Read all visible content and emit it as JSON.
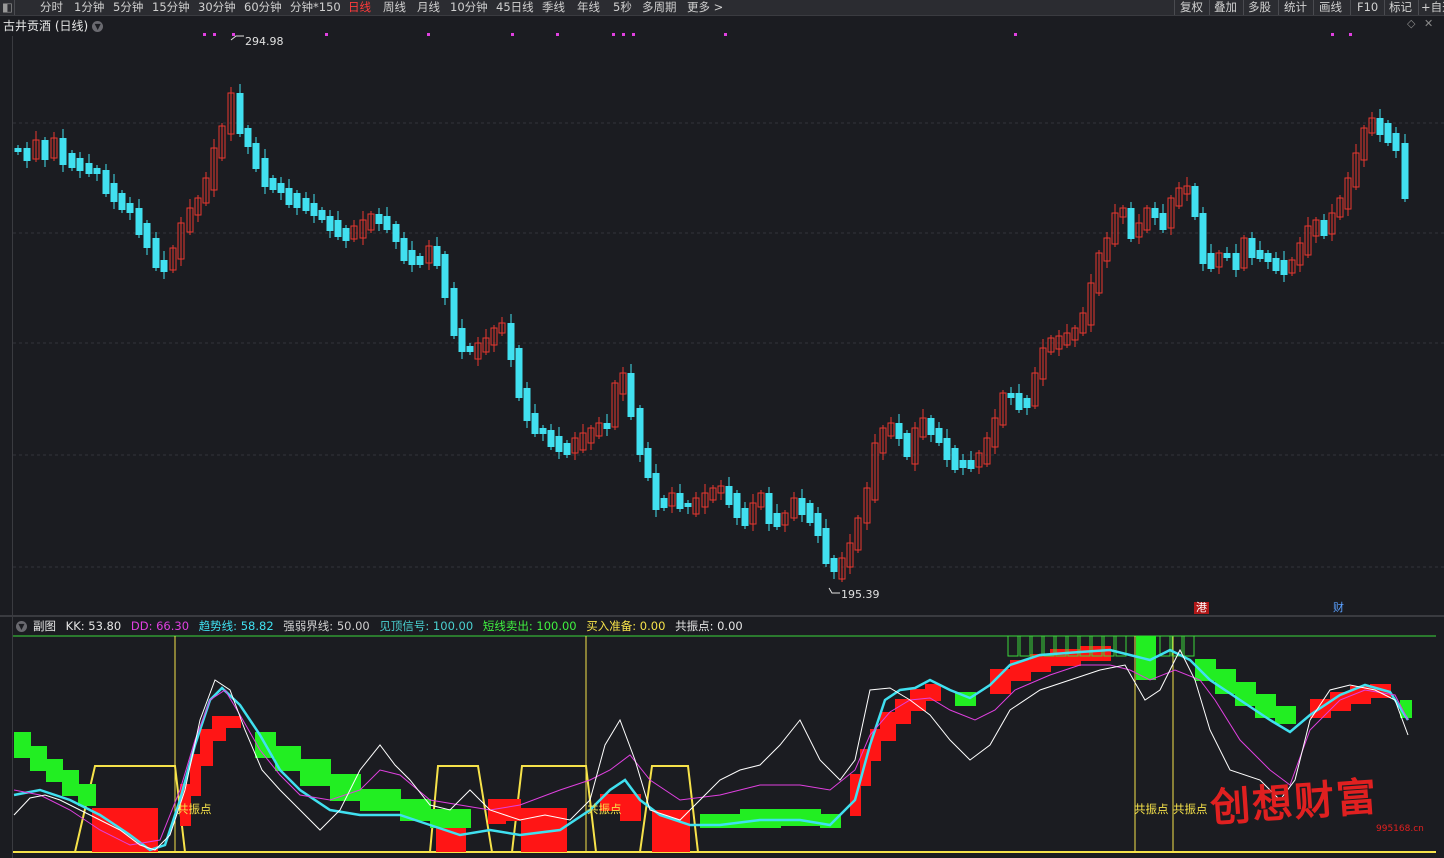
{
  "toolbar": {
    "periods": [
      "分时",
      "1分钟",
      "5分钟",
      "15分钟",
      "30分钟",
      "60分钟",
      "分钟*150",
      "日线",
      "周线",
      "月线",
      "10分钟",
      "45日线",
      "季线",
      "年线",
      "5秒",
      "多周期",
      "更多 >"
    ],
    "active_period": "日线",
    "right_buttons": [
      "复权",
      "叠加",
      "多股",
      "统计",
      "画线",
      "F10",
      "标记",
      "+自选"
    ]
  },
  "main_chart": {
    "title": "古井贡酒 (日线)",
    "high_label": "294.98",
    "low_label": "195.39",
    "tag_hk": "港",
    "tag_finance": "财"
  },
  "sub_chart": {
    "name": "副图",
    "indicators": [
      {
        "label": "KK: 53.80",
        "color": "#e6e6e6"
      },
      {
        "label": "DD: 66.30",
        "color": "#e040e0"
      },
      {
        "label": "趋势线: 58.82",
        "color": "#40e0f0"
      },
      {
        "label": "强弱界线: 50.00",
        "color": "#e6e6e6"
      },
      {
        "label": "见顶信号: 100.00",
        "color": "#4ad0d0"
      },
      {
        "label": "短线卖出: 100.00",
        "color": "#40f040"
      },
      {
        "label": "买入准备: 0.00",
        "color": "#f6e24a"
      },
      {
        "label": "共振点: 0.00",
        "color": "#e6e6e6"
      }
    ],
    "resonance_label": "共振点"
  },
  "watermark": {
    "text": "创想财富",
    "url": "995168.cn"
  },
  "colors": {
    "up": "#e8372f",
    "down": "#41e0f0",
    "bg": "#1b1c21"
  }
}
